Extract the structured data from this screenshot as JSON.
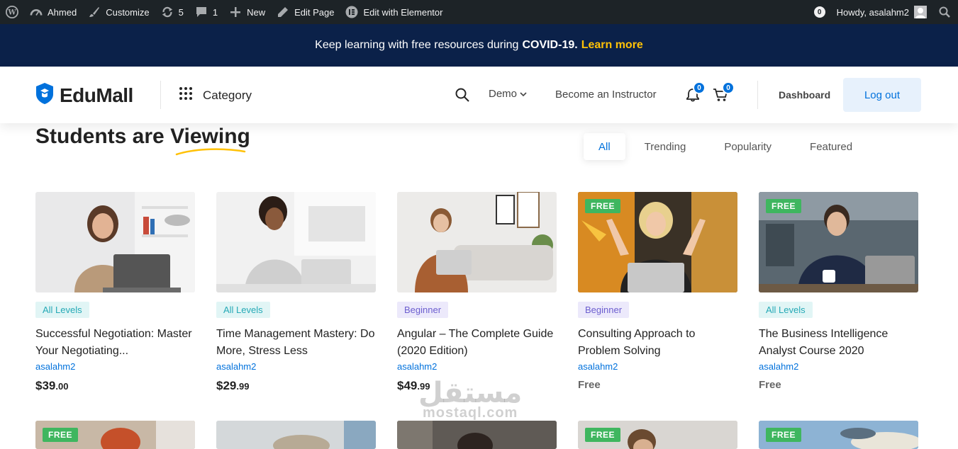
{
  "adminbar": {
    "site_name": "Ahmed",
    "customize": "Customize",
    "updates_count": "5",
    "comments_count": "1",
    "new": "New",
    "edit_page": "Edit Page",
    "edit_elementor": "Edit with Elementor",
    "notif_count": "0",
    "howdy": "Howdy, asalahm2"
  },
  "banner": {
    "text": "Keep learning with free resources during",
    "highlight": "COVID-19.",
    "link": "Learn more"
  },
  "header": {
    "logo": "EduMall",
    "category": "Category",
    "demo": "Demo",
    "become_instructor": "Become an Instructor",
    "notif_count": "0",
    "cart_count": "0",
    "dashboard": "Dashboard",
    "logout": "Log out"
  },
  "section": {
    "title_prefix": "Students are",
    "title_highlight": "Viewing",
    "tabs": [
      "All",
      "Trending",
      "Popularity",
      "Featured"
    ]
  },
  "courses": [
    {
      "level": "All Levels",
      "title": "Successful Negotiation: Master Your Negotiating...",
      "instructor": "asalahm2",
      "price_main": "$39",
      "price_cents": ".00",
      "free_tag": ""
    },
    {
      "level": "All Levels",
      "title": "Time Management Mastery: Do More, Stress Less",
      "instructor": "asalahm2",
      "price_main": "$29",
      "price_cents": ".99",
      "free_tag": ""
    },
    {
      "level": "Beginner",
      "title": "Angular – The Complete Guide (2020 Edition)",
      "instructor": "asalahm2",
      "price_main": "$49",
      "price_cents": ".99",
      "free_tag": ""
    },
    {
      "level": "Beginner",
      "title": "Consulting Approach to Problem Solving",
      "instructor": "asalahm2",
      "price_main": "Free",
      "price_cents": "",
      "free_tag": "FREE"
    },
    {
      "level": "All Levels",
      "title": "The Business Intelligence Analyst Course 2020",
      "instructor": "asalahm2",
      "price_main": "Free",
      "price_cents": "",
      "free_tag": "FREE"
    }
  ],
  "row2_tags": [
    "FREE",
    "",
    "",
    "FREE",
    "FREE"
  ],
  "watermark": {
    "arabic": "مستقل",
    "latin": "mostaql.com"
  },
  "colors": {
    "accent": "#0071dc",
    "banner_bg": "#0b2149",
    "banner_link": "#ffc107",
    "free_tag": "#3fb65f"
  }
}
